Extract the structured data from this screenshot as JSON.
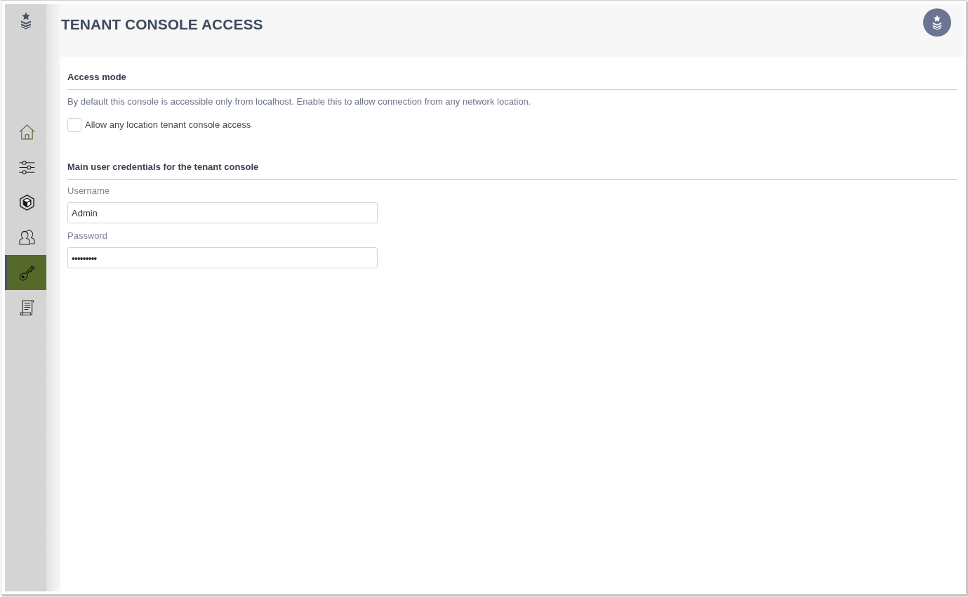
{
  "sidebar": {
    "items": [
      {
        "kind": "home",
        "selected": false
      },
      {
        "kind": "sliders",
        "selected": false
      },
      {
        "kind": "cube",
        "selected": false
      },
      {
        "kind": "users",
        "selected": false
      },
      {
        "kind": "key",
        "selected": true
      },
      {
        "kind": "document",
        "selected": false
      }
    ]
  },
  "header": {
    "title": "TENANT CONSOLE ACCESS"
  },
  "sections": [
    {
      "heading": "Access mode",
      "description": "By default this console is accessible only from localhost. Enable this to allow connection from any network location.",
      "checkbox": {
        "label": "Allow any location tenant console access",
        "checked": false
      }
    },
    {
      "heading": "Main user credentials for the tenant console",
      "fields": [
        {
          "kind": "text",
          "label": "Username",
          "value": "Admin"
        },
        {
          "kind": "password",
          "label": "Password",
          "value": "•••••••••"
        }
      ]
    }
  ]
}
